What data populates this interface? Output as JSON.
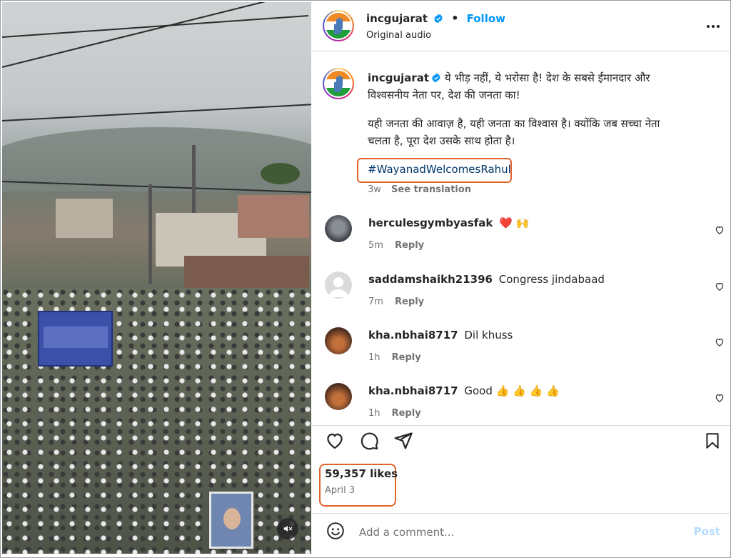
{
  "post": {
    "username": "incgujarat",
    "follow_label": "Follow",
    "audio": "Original audio",
    "more_label": "•••"
  },
  "caption": {
    "username": "incgujarat",
    "line1": "ये भीड़ नहीं, ये भरोसा है! देश के सबसे ईमानदार और",
    "line2": "विश्वसनीय नेता पर, देश की जनता का!",
    "line3": "यही जनता की आवाज़ है, यही जनता का विश्वास है। क्योंकि जब सच्चा नेता",
    "line4": "चलता है, पूरा देश उसके साथ होता है।",
    "hashtag": "#WayanadWelcomesRahul",
    "age": "3w",
    "see_translation": "See translation"
  },
  "comments": [
    {
      "user": "herculesgymbyasfak",
      "text": "❤️ 🙌",
      "age": "5m",
      "reply": "Reply",
      "avatar": "gym-avatar"
    },
    {
      "user": "saddamshaikh21396",
      "text": "Congress jindabaad",
      "age": "7m",
      "reply": "Reply",
      "avatar": "default-avatar"
    },
    {
      "user": "kha.nbhai8717",
      "text": "Dil khuss",
      "age": "1h",
      "reply": "Reply",
      "avatar": "crowd-avatar"
    },
    {
      "user": "kha.nbhai8717",
      "text": "Good 👍 👍 👍 👍",
      "age": "1h",
      "reply": "Reply",
      "avatar": "crowd-avatar"
    }
  ],
  "stats": {
    "likes": "59,357 likes",
    "date": "April 3"
  },
  "composer": {
    "placeholder": "Add a comment...",
    "post_label": "Post"
  },
  "icons": {
    "like": "heart-icon",
    "comment": "comment-icon",
    "share": "paper-plane-icon",
    "save": "bookmark-icon",
    "emoji": "smiley-icon",
    "mute": "speaker-muted-icon",
    "verified": "verified-badge-icon"
  },
  "colors": {
    "follow": "#0095f6",
    "hashtag": "#00376b",
    "highlight": "#e0632e",
    "heart": "#ed4956",
    "verified": "#0095f6"
  }
}
